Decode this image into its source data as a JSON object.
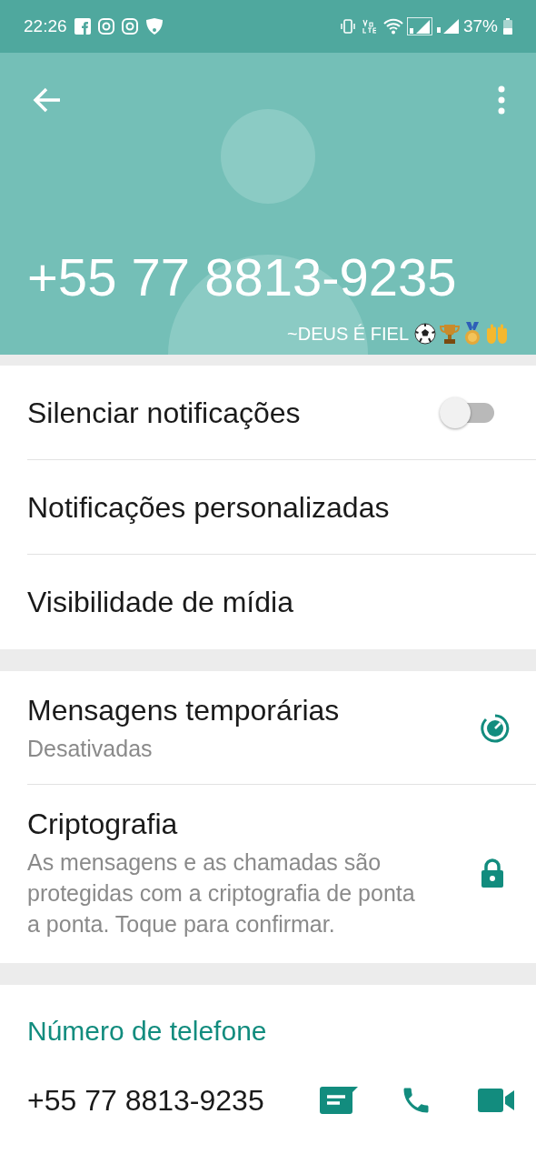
{
  "status_bar": {
    "time": "22:26",
    "battery": "37%"
  },
  "header": {
    "name": "+55 77 8813-9235",
    "about": "~DEUS É FIEL"
  },
  "sections": [
    {
      "items": [
        {
          "kind": "toggle",
          "title": "Silenciar notificações",
          "on": false
        },
        {
          "kind": "plain",
          "title": "Notificações personalizadas"
        },
        {
          "kind": "plain",
          "title": "Visibilidade de mídia"
        }
      ]
    },
    {
      "items": [
        {
          "kind": "timer",
          "title": "Mensagens temporárias",
          "subtitle": "Desativadas"
        },
        {
          "kind": "lock",
          "title": "Criptografia",
          "subtitle": "As mensagens e as chamadas são protegidas com a criptografia de ponta a ponta. Toque para confirmar."
        }
      ]
    }
  ],
  "phone": {
    "heading": "Número de telefone",
    "number": "+55 77 8813-9235"
  }
}
